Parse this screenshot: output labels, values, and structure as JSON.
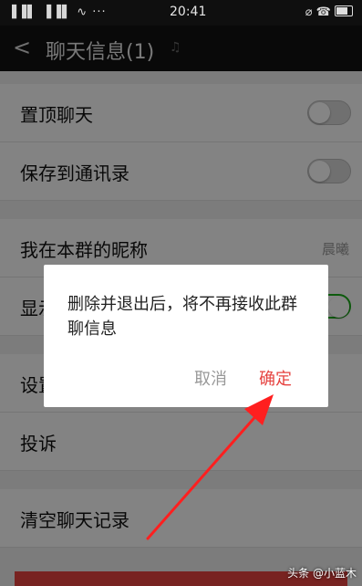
{
  "status_bar": {
    "signal": "▐▐▌ ▐▐▌ ∿ ···",
    "time": "20:41",
    "right_icons": "⌀ ☎"
  },
  "header": {
    "back": "<",
    "title": "聊天信息(1)",
    "mute_icon": "♫"
  },
  "settings": {
    "pin_chat": {
      "label": "置顶聊天",
      "on": false
    },
    "save_contacts": {
      "label": "保存到通讯录",
      "on": false
    },
    "nickname": {
      "label": "我在本群的昵称",
      "value": "晨曦"
    },
    "show_nicknames": {
      "label": "显示群成员昵称",
      "on": true
    },
    "background": {
      "label": "设置当前聊天背景"
    },
    "report": {
      "label": "投诉"
    },
    "clear_history": {
      "label": "清空聊天记录"
    }
  },
  "dialog": {
    "message": "删除并退出后，将不再接收此群聊信息",
    "cancel": "取消",
    "confirm": "确定"
  },
  "watermark": "头条 @小蓝木",
  "colors": {
    "accent_green": "#1aad19",
    "danger_red": "#e64340",
    "arrow_red": "#ff1f1f"
  }
}
